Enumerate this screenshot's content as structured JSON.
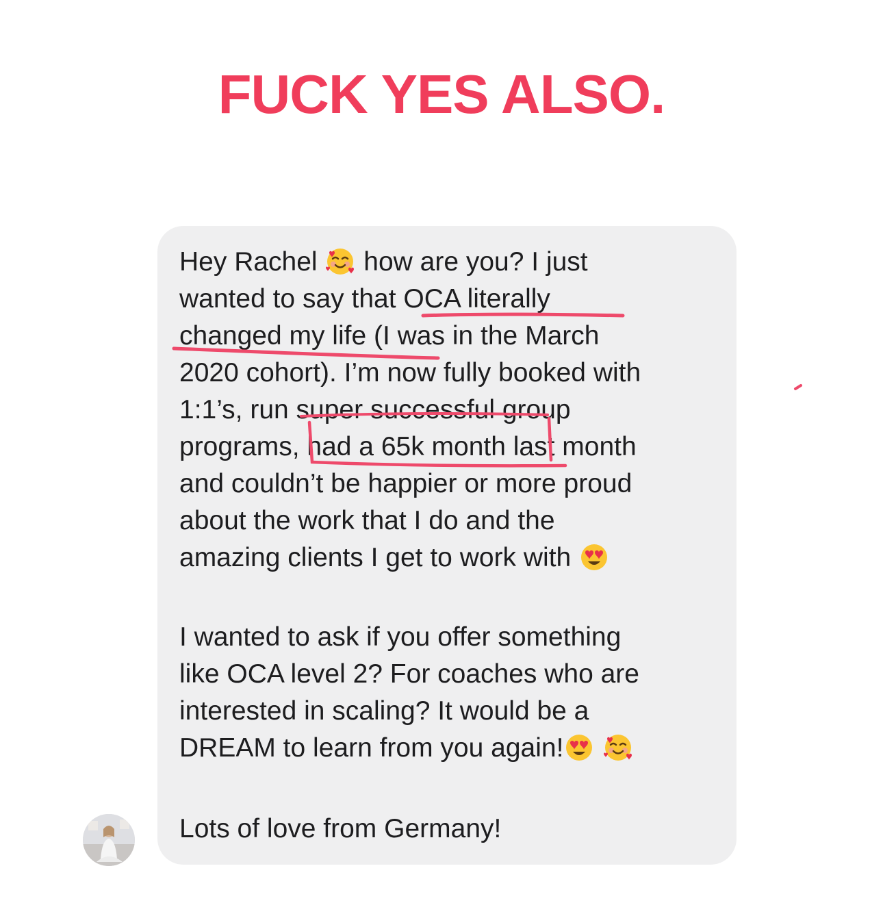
{
  "headline": {
    "text": "FUCK YES ALSO.",
    "color": "#f03d5b"
  },
  "message": {
    "bubble_color": "#efeff0",
    "text_color": "#1d1d1f",
    "lines": [
      "Hey Rachel",
      "how are you? I just",
      "wanted to say that OCA literally",
      "changed my life (I was in the March",
      "2020 cohort). I’m now fully booked with",
      "1:1’s, run super successful group",
      "programs, had a 65k month last month",
      "and couldn’t be happier or more proud",
      "about the work that I do and the",
      "amazing clients I get to work with",
      "I wanted to ask if you offer something",
      "like OCA level 2? For coaches who are",
      "interested in scaling? It would be a",
      "DREAM to learn from you again!",
      "Lots of love from Germany!"
    ],
    "emojis": {
      "smiling_hearts": "smiling-face-with-hearts-emoji",
      "heart_eyes": "heart-eyes-emoji"
    }
  },
  "annotations": {
    "color": "#ee4a6b",
    "style": "hand-drawn underline and box"
  },
  "sender": {
    "avatar_icon": "profile-photo-avatar"
  }
}
